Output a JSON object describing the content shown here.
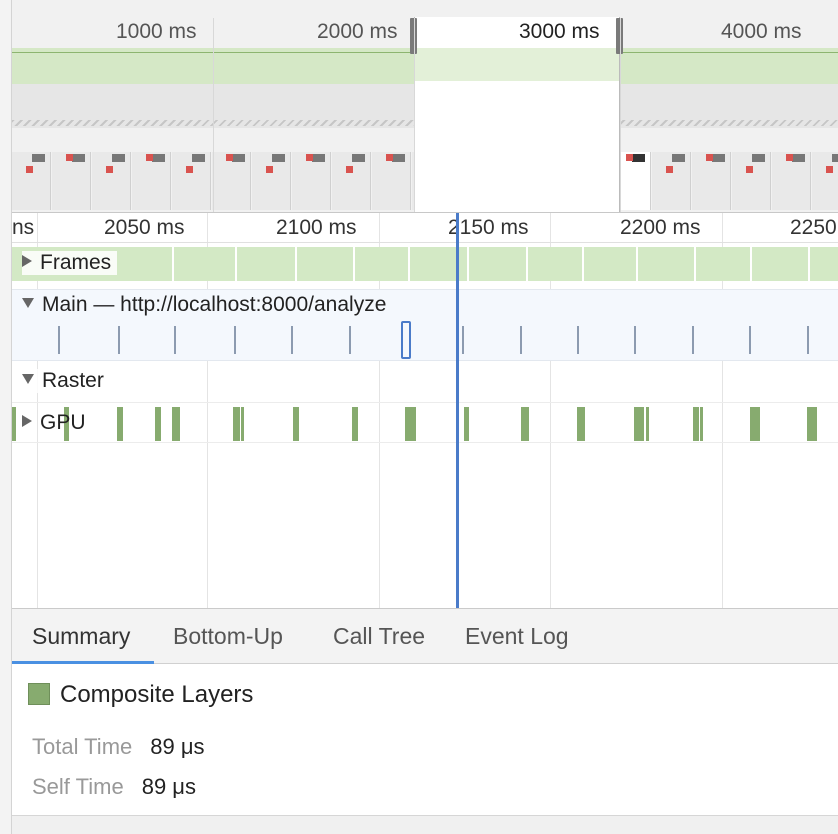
{
  "overview": {
    "ruler_labels": [
      "1000 ms",
      "2000 ms",
      "3000 ms",
      "4000 ms"
    ]
  },
  "flame": {
    "ruler_labels": [
      "ns",
      "2050 ms",
      "2100 ms",
      "2150 ms",
      "2200 ms",
      "2250"
    ],
    "tracks": {
      "frames": "Frames",
      "main": "Main — http://localhost:8000/analyze",
      "raster": "Raster",
      "gpu": "GPU"
    }
  },
  "details": {
    "tabs": [
      "Summary",
      "Bottom-Up",
      "Call Tree",
      "Event Log"
    ],
    "active_tab": "Summary",
    "event_name": "Composite Layers",
    "total_time_label": "Total Time",
    "total_time_value": "89 μs",
    "self_time_label": "Self Time",
    "self_time_value": "89 μs",
    "swatch_color": "#87ab6f"
  }
}
